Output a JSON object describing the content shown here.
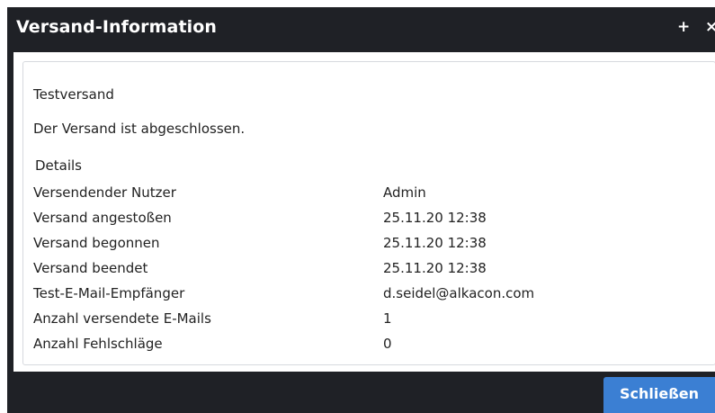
{
  "dialog": {
    "title": "Versand-Information",
    "plus_glyph": "+",
    "close_glyph": "×",
    "close_button_label": "Schließen"
  },
  "content": {
    "subject": "Testversand",
    "status": "Der Versand ist abgeschlossen.",
    "details_title": "Details",
    "details": [
      {
        "label": "Versendender Nutzer",
        "value": "Admin"
      },
      {
        "label": "Versand angestoßen",
        "value": "25.11.20 12:38"
      },
      {
        "label": "Versand begonnen",
        "value": "25.11.20 12:38"
      },
      {
        "label": "Versand beendet",
        "value": "25.11.20 12:38"
      },
      {
        "label": "Test-E-Mail-Empfänger",
        "value": "d.seidel@alkacon.com"
      },
      {
        "label": "Anzahl versendete E-Mails",
        "value": "1"
      },
      {
        "label": "Anzahl Fehlschläge",
        "value": "0"
      }
    ]
  },
  "colors": {
    "dialog_background": "#1f2126",
    "button_background": "#3b7fd3",
    "panel_border": "#d6d9de",
    "text": "#222222"
  }
}
